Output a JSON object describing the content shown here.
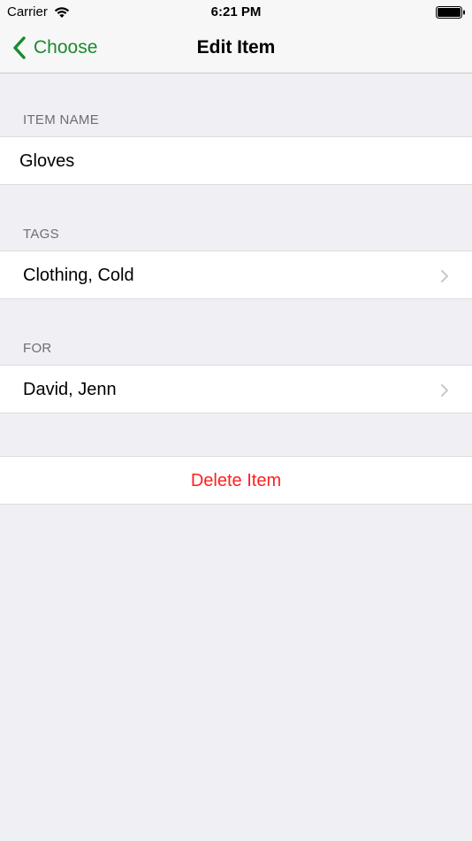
{
  "status_bar": {
    "carrier": "Carrier",
    "time": "6:21 PM"
  },
  "nav": {
    "back_label": "Choose",
    "title": "Edit Item"
  },
  "sections": {
    "item_name": {
      "header": "ITEM NAME",
      "value": "Gloves"
    },
    "tags": {
      "header": "TAGS",
      "value": "Clothing, Cold"
    },
    "for": {
      "header": "FOR",
      "value": "David, Jenn"
    }
  },
  "delete_label": "Delete Item",
  "colors": {
    "accent": "#1a8a2c",
    "destructive": "#ff1f1f",
    "background": "#efeff4"
  }
}
